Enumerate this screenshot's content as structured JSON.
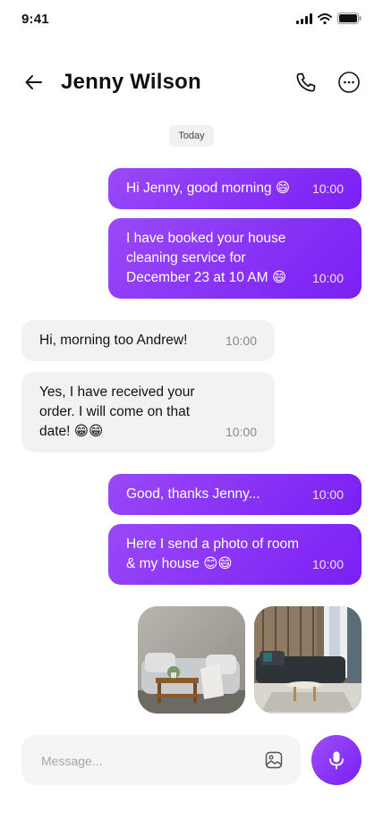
{
  "status_bar": {
    "time": "9:41"
  },
  "header": {
    "contact_name": "Jenny Wilson"
  },
  "date_divider": "Today",
  "messages": [
    {
      "text": "Hi Jenny, good morning 😄",
      "time": "10:00"
    },
    {
      "text": "I have booked your house cleaning service for December 23 at 10 AM 😄",
      "lines": [
        "I have booked your house",
        "cleaning service for",
        "December 23 at 10 AM 😄"
      ],
      "time": "10:00"
    },
    {
      "text": "Hi, morning too Andrew!",
      "time": "10:00"
    },
    {
      "text": "Yes, I have received your order. I will come on that date! 😁😁",
      "lines": [
        "Yes, I have received your",
        "order. I will come on that",
        "date! 😁😁"
      ],
      "time": "10:00"
    },
    {
      "text": "Good, thanks Jenny...",
      "time": "10:00"
    },
    {
      "text": "Here I send a photo of room & my house 😊😄",
      "lines": [
        "Here I send a photo of room",
        "& my house 😊😄"
      ],
      "time": "10:00"
    }
  ],
  "composer": {
    "placeholder": "Message..."
  },
  "colors": {
    "accent": "#8a33f6",
    "incoming_bubble": "#f2f2f2"
  }
}
